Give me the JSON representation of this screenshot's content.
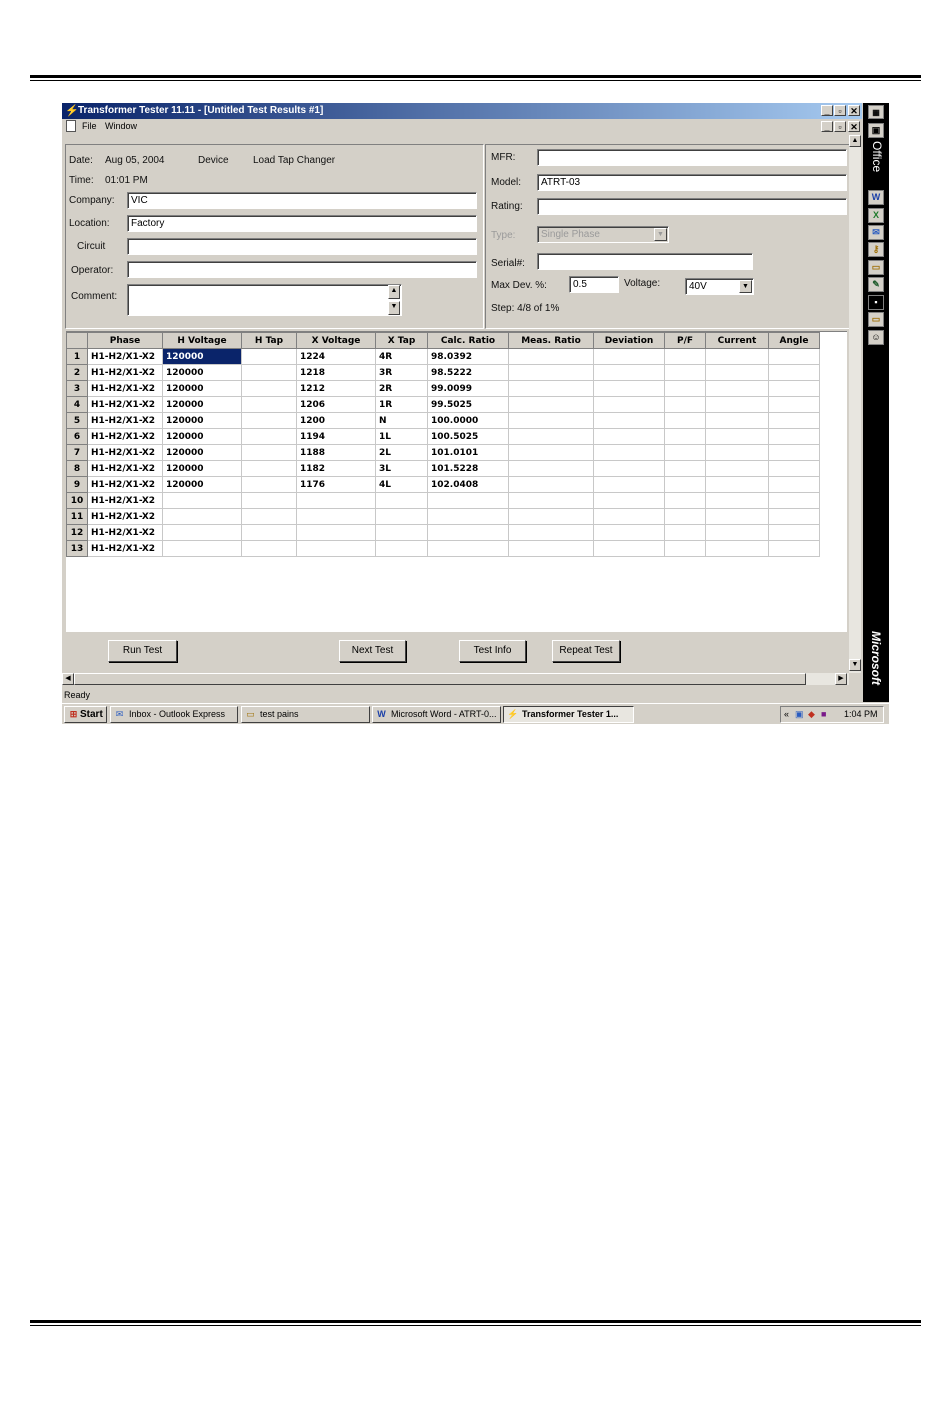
{
  "window": {
    "title": "Transformer Tester 11.11 - [Untitled Test Results #1]",
    "menu": [
      "File",
      "Window"
    ]
  },
  "info": {
    "date_label": "Date:",
    "date_value": "Aug 05, 2004",
    "device_label": "Device",
    "device_value": "Load Tap Changer",
    "time_label": "Time:",
    "time_value": "01:01 PM",
    "company_label": "Company:",
    "company_value": "VIC",
    "location_label": "Location:",
    "location_value": "Factory",
    "circuit_label": "Circuit",
    "circuit_value": "",
    "operator_label": "Operator:",
    "operator_value": "",
    "comment_label": "Comment:",
    "comment_value": ""
  },
  "transformer": {
    "mfr_label": "MFR:",
    "mfr_value": "",
    "model_label": "Model:",
    "model_value": "ATRT-03",
    "rating_label": "Rating:",
    "rating_value": "",
    "type_label": "Type:",
    "type_value": "Single Phase",
    "serial_label": "Serial#:",
    "serial_value": "",
    "maxdev_label": "Max Dev. %:",
    "maxdev_value": "0.5",
    "voltage_label": "Voltage:",
    "voltage_value": "40V",
    "step_text": "Step: 4/8 of 1%"
  },
  "grid": {
    "columns": [
      "Phase",
      "H Voltage",
      "H Tap",
      "X Voltage",
      "X Tap",
      "Calc. Ratio",
      "Meas. Ratio",
      "Deviation",
      "P/F",
      "Current",
      "Angle"
    ],
    "rows": [
      [
        "1",
        "H1-H2/X1-X2",
        "120000",
        "",
        "1224",
        "4R",
        "98.0392",
        "",
        "",
        "",
        "",
        ""
      ],
      [
        "2",
        "H1-H2/X1-X2",
        "120000",
        "",
        "1218",
        "3R",
        "98.5222",
        "",
        "",
        "",
        "",
        ""
      ],
      [
        "3",
        "H1-H2/X1-X2",
        "120000",
        "",
        "1212",
        "2R",
        "99.0099",
        "",
        "",
        "",
        "",
        ""
      ],
      [
        "4",
        "H1-H2/X1-X2",
        "120000",
        "",
        "1206",
        "1R",
        "99.5025",
        "",
        "",
        "",
        "",
        ""
      ],
      [
        "5",
        "H1-H2/X1-X2",
        "120000",
        "",
        "1200",
        "N",
        "100.0000",
        "",
        "",
        "",
        "",
        ""
      ],
      [
        "6",
        "H1-H2/X1-X2",
        "120000",
        "",
        "1194",
        "1L",
        "100.5025",
        "",
        "",
        "",
        "",
        ""
      ],
      [
        "7",
        "H1-H2/X1-X2",
        "120000",
        "",
        "1188",
        "2L",
        "101.0101",
        "",
        "",
        "",
        "",
        ""
      ],
      [
        "8",
        "H1-H2/X1-X2",
        "120000",
        "",
        "1182",
        "3L",
        "101.5228",
        "",
        "",
        "",
        "",
        ""
      ],
      [
        "9",
        "H1-H2/X1-X2",
        "120000",
        "",
        "1176",
        "4L",
        "102.0408",
        "",
        "",
        "",
        "",
        ""
      ],
      [
        "10",
        "H1-H2/X1-X2",
        "",
        "",
        "",
        "",
        "",
        "",
        "",
        "",
        "",
        ""
      ],
      [
        "11",
        "H1-H2/X1-X2",
        "",
        "",
        "",
        "",
        "",
        "",
        "",
        "",
        "",
        ""
      ],
      [
        "12",
        "H1-H2/X1-X2",
        "",
        "",
        "",
        "",
        "",
        "",
        "",
        "",
        "",
        ""
      ],
      [
        "13",
        "H1-H2/X1-X2",
        "",
        "",
        "",
        "",
        "",
        "",
        "",
        "",
        "",
        ""
      ]
    ]
  },
  "buttons": {
    "run_test": "Run Test",
    "next_test": "Next Test",
    "test_info": "Test Info",
    "repeat_test": "Repeat Test"
  },
  "status": {
    "text": "Ready"
  },
  "taskbar": {
    "start": "Start",
    "items": [
      "Inbox - Outlook Express",
      "test pains",
      "Microsoft Word - ATRT-0...",
      "Transformer Tester 1..."
    ],
    "clock": "1:04 PM",
    "tray_chevron": "«"
  },
  "officebar": {
    "top_text": "Office",
    "bottom_text": "Microsoft"
  },
  "colors": {
    "selection": "#0a246a",
    "face": "#d4d0c8",
    "title_start": "#0a246a",
    "title_end": "#a6caf0"
  }
}
